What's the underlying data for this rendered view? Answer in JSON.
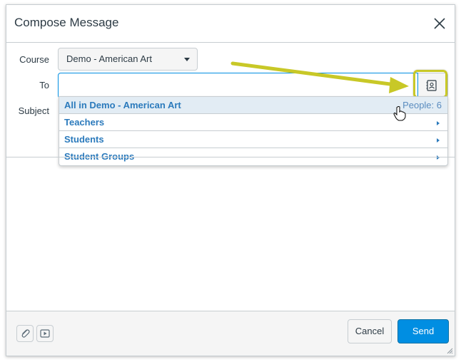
{
  "dialog": {
    "title": "Compose Message"
  },
  "form": {
    "course_label": "Course",
    "course_value": "Demo - American Art",
    "to_label": "To",
    "to_value": "",
    "subject_label": "Subject"
  },
  "recipients_menu": {
    "items": [
      {
        "label": "All in Demo - American Art",
        "meta": "People: 6"
      },
      {
        "label": "Teachers"
      },
      {
        "label": "Students"
      },
      {
        "label": "Student Groups"
      }
    ]
  },
  "footer": {
    "cancel_label": "Cancel",
    "send_label": "Send"
  },
  "colors": {
    "accent": "#008ee2",
    "link": "#2b7abc",
    "annotation": "#c8c827"
  },
  "icons": [
    "close-icon",
    "address-book-icon",
    "attachment-icon",
    "media-icon",
    "caret-down-icon",
    "caret-right-icon",
    "resize-handle-icon"
  ]
}
